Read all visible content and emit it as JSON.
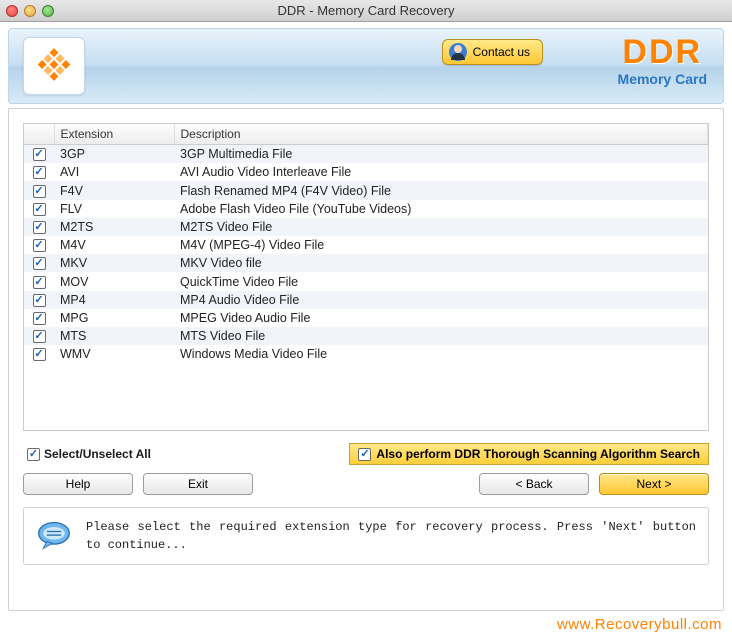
{
  "window": {
    "title": "DDR - Memory Card Recovery"
  },
  "banner": {
    "contact_label": "Contact us",
    "brand_main": "DDR",
    "brand_sub": "Memory Card"
  },
  "table": {
    "headers": {
      "checkbox": "",
      "extension": "Extension",
      "description": "Description"
    },
    "rows": [
      {
        "checked": true,
        "ext": "3GP",
        "desc": "3GP Multimedia File"
      },
      {
        "checked": true,
        "ext": "AVI",
        "desc": "AVI Audio Video Interleave File"
      },
      {
        "checked": true,
        "ext": "F4V",
        "desc": "Flash Renamed MP4 (F4V Video) File"
      },
      {
        "checked": true,
        "ext": "FLV",
        "desc": "Adobe Flash Video File (YouTube Videos)"
      },
      {
        "checked": true,
        "ext": "M2TS",
        "desc": "M2TS Video File"
      },
      {
        "checked": true,
        "ext": "M4V",
        "desc": "M4V (MPEG-4) Video File"
      },
      {
        "checked": true,
        "ext": "MKV",
        "desc": "MKV Video file"
      },
      {
        "checked": true,
        "ext": "MOV",
        "desc": "QuickTime Video File"
      },
      {
        "checked": true,
        "ext": "MP4",
        "desc": "MP4 Audio Video File"
      },
      {
        "checked": true,
        "ext": "MPG",
        "desc": "MPEG Video Audio File"
      },
      {
        "checked": true,
        "ext": "MTS",
        "desc": "MTS Video File"
      },
      {
        "checked": true,
        "ext": "WMV",
        "desc": "Windows Media Video File"
      }
    ]
  },
  "controls": {
    "select_all_label": "Select/Unselect All",
    "select_all_checked": true,
    "thorough_label": "Also perform DDR Thorough Scanning Algorithm Search",
    "thorough_checked": true,
    "help_label": "Help",
    "exit_label": "Exit",
    "back_label": "< Back",
    "next_label": "Next >"
  },
  "info": {
    "text": "Please select the required extension type for recovery process. Press 'Next' button to continue..."
  },
  "footer": {
    "watermark": "www.Recoverybull.com"
  }
}
